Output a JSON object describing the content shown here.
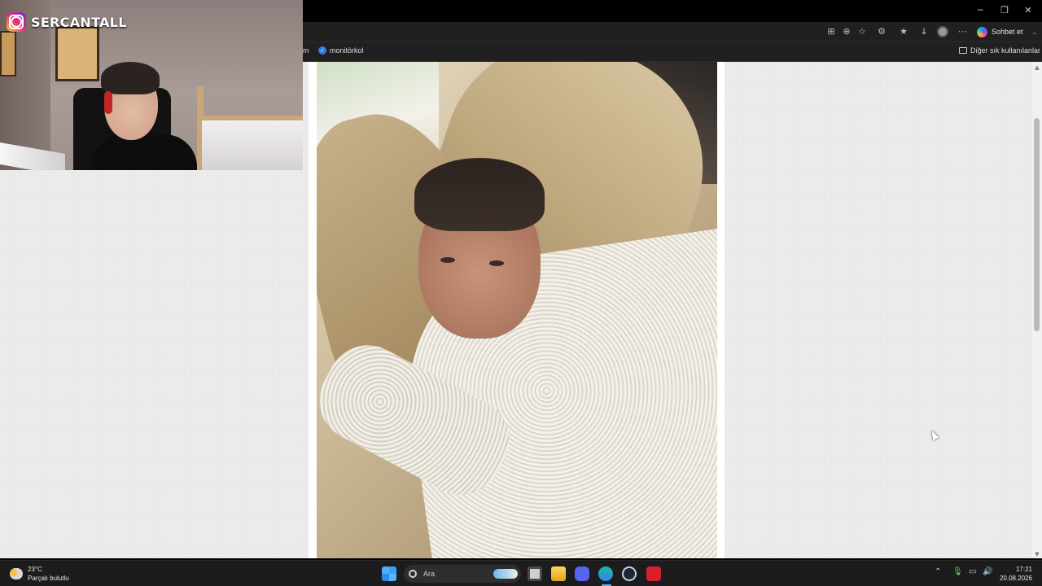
{
  "browser": {
    "bookmark_left_fragment": "m",
    "bookmark_item": "monitörkol",
    "other_favorites": "Diğer sık kullanılanlar",
    "chat_button": "Sohbet et",
    "toolbar_icons": [
      "app-icon",
      "zoom-icon",
      "star-icon",
      "extensions-icon",
      "favorites-icon",
      "download-icon",
      "profile-icon",
      "more-icon"
    ]
  },
  "window_controls": {
    "minimize": "─",
    "restore": "❐",
    "close": "✕"
  },
  "stream_overlay": {
    "brand": "SERCANTALL",
    "platform_icon": "instagram-icon"
  },
  "taskbar": {
    "weather": {
      "temperature": "23°C",
      "condition": "Parçalı bulutlu"
    },
    "search_placeholder": "Ara",
    "apps": [
      "windows-start-icon",
      "task-view-icon",
      "file-explorer-icon",
      "discord-icon",
      "edge-icon",
      "steam-icon",
      "app-red-icon"
    ],
    "clock": {
      "time": "17:21",
      "date": "20.08.2026"
    }
  },
  "colors": {
    "accent": "#2f7de1",
    "page_bg": "#ececec",
    "taskbar_bg": "#1c1c1c"
  }
}
